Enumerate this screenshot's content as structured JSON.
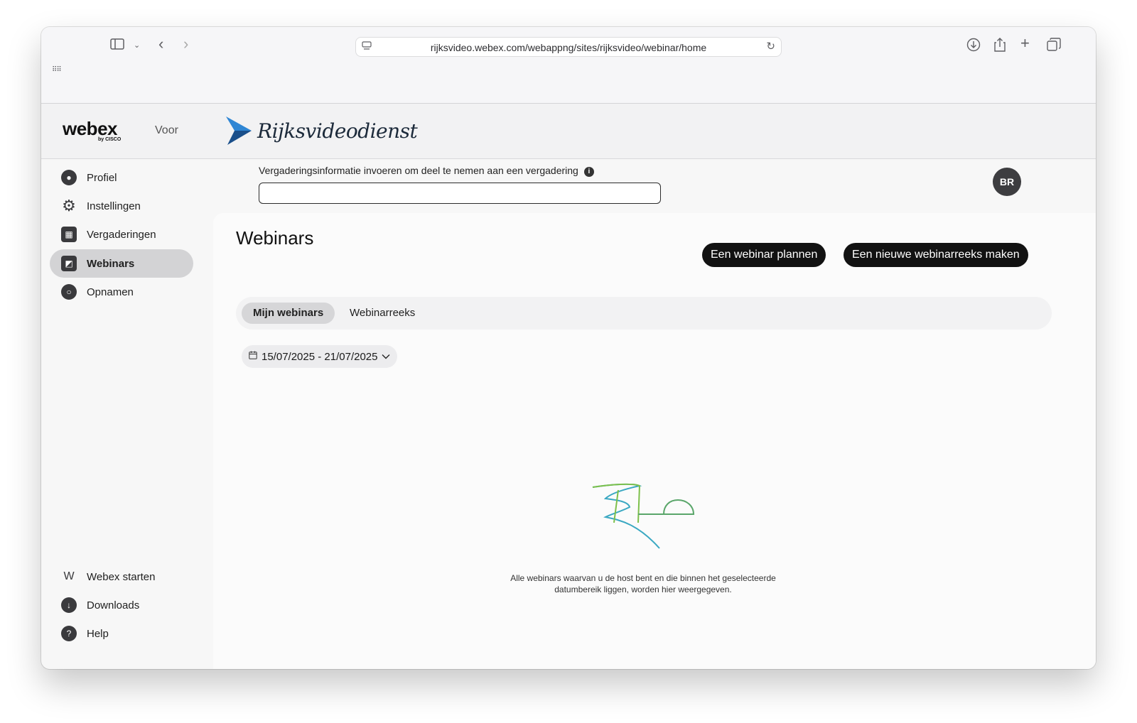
{
  "browser": {
    "url": "rijksvideo.webex.com/webappng/sites/rijksvideo/webinar/home",
    "icons": [
      "sidebar-icon",
      "chevron-down-icon",
      "back-icon",
      "forward-icon",
      "site-settings-icon",
      "reload-icon",
      "download-icon",
      "share-icon",
      "new-tab-icon",
      "tab-overview-icon",
      "grid-icon"
    ]
  },
  "header": {
    "logo": "webex",
    "logo_sub": "by CISCO",
    "voor": "Voor",
    "org_name": "Rijksvideodienst"
  },
  "sidebar": {
    "items": [
      {
        "label": "Profiel",
        "icon": "profile-icon"
      },
      {
        "label": "Instellingen",
        "icon": "gear-icon"
      },
      {
        "label": "Vergaderingen",
        "icon": "calendar-icon"
      },
      {
        "label": "Webinars",
        "icon": "webinar-icon",
        "active": true
      },
      {
        "label": "Opnamen",
        "icon": "recording-icon"
      }
    ],
    "bottom_items": [
      {
        "label": "Webex starten",
        "icon": "webex-icon"
      },
      {
        "label": "Downloads",
        "icon": "download-icon"
      },
      {
        "label": "Help",
        "icon": "help-icon"
      }
    ]
  },
  "join": {
    "label": "Vergaderingsinformatie invoeren om deel te nemen aan een vergadering",
    "value": "",
    "placeholder": ""
  },
  "user": {
    "initials": "BR"
  },
  "main": {
    "title": "Webinars",
    "schedule_button": "Een webinar plannen",
    "series_button": "Een nieuwe webinarreeks maken",
    "tabs": [
      {
        "label": "Mijn webinars",
        "active": true
      },
      {
        "label": "Webinarreeks",
        "active": false
      }
    ],
    "date_range": "15/07/2025 - 21/07/2025",
    "empty_line1": "Alle webinars waarvan u de host bent en die binnen het geselecteerde",
    "empty_line2": "datumbereik liggen, worden hier weergegeven."
  },
  "colors": {
    "accent_dark": "#121212",
    "rv_blue": "#1a6fc4",
    "illus_green": "#7dc04b",
    "illus_teal": "#3aa8c2"
  }
}
